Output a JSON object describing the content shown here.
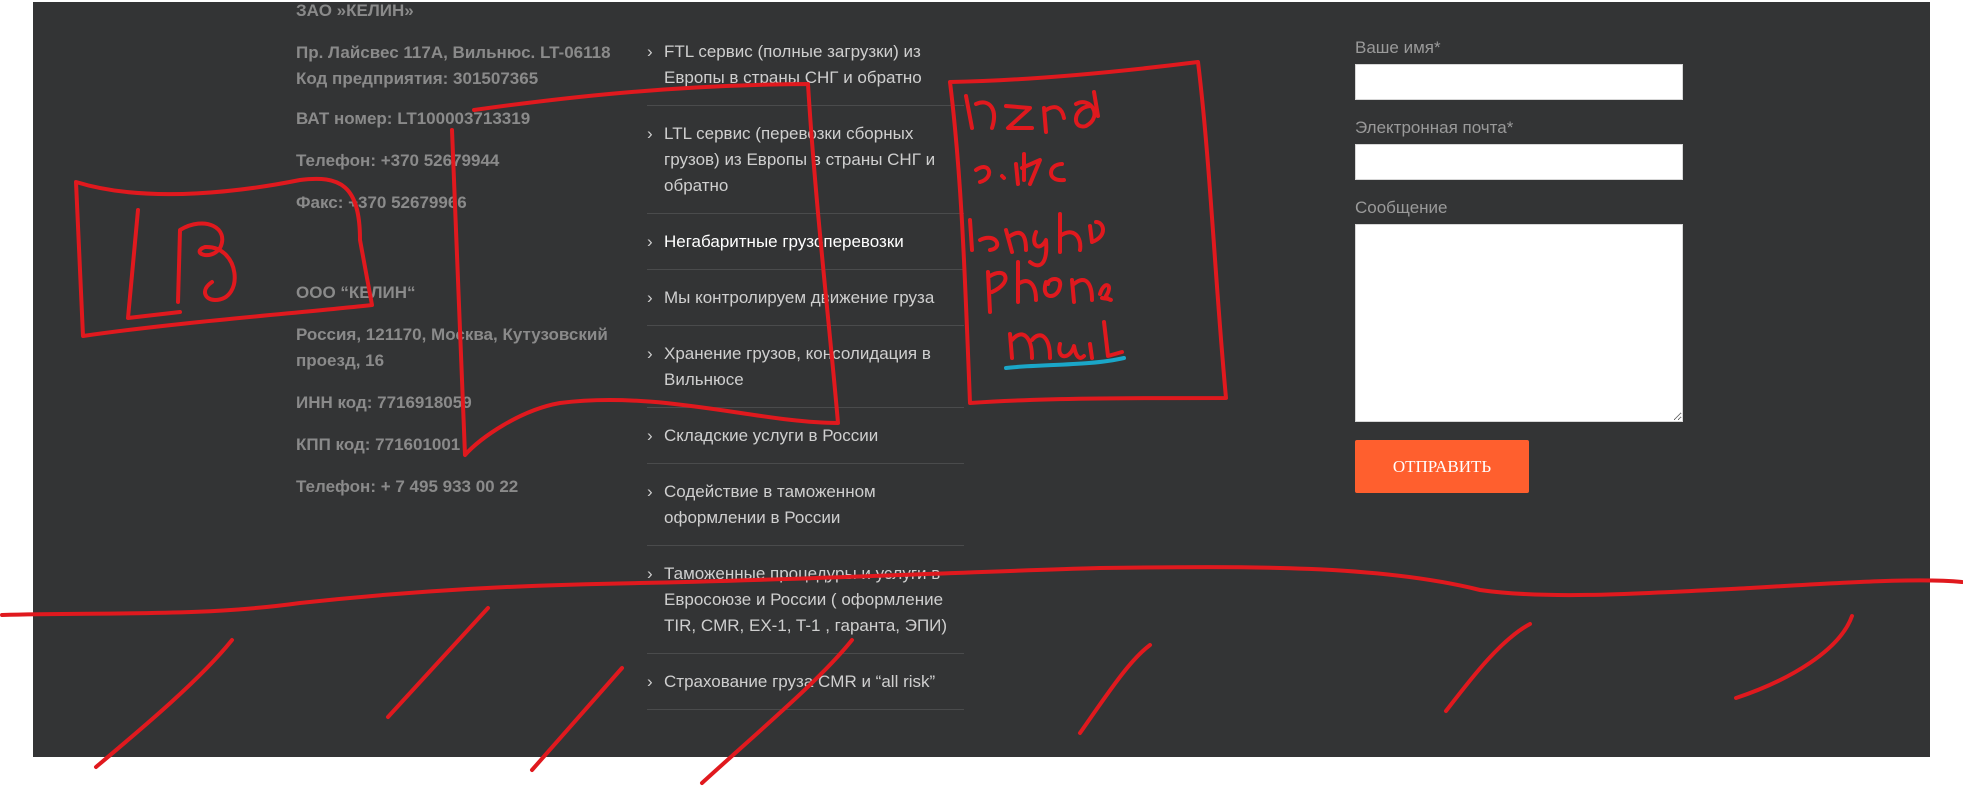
{
  "company_lt": {
    "name": "ЗАО »КЕЛИН»",
    "address": "Пр. Лайсвес 117А, Вильнюс. LT-06118",
    "company_code": "Код предприятия: 301507365",
    "vat": "ВАТ номер: LT100003713319",
    "phone": "Телефон: +370 52679944",
    "fax": "Факс: +370 52679966"
  },
  "company_ru": {
    "name": "ООО “КЕЛИН“",
    "address": "Россия, 121170, Москва, Кутузовский проезд, 16",
    "inn": "ИНН код: 7716918059",
    "kpp": "КПП код: 771601001",
    "phone": "Телефон: + 7 495 933 00 22"
  },
  "services": [
    "FTL сервис (полные загрузки) из Европы в страны СНГ и обратно",
    "LTL сервис (перевозки сборных грузов) из Европы в страны СНГ и обратно",
    "Негабаритные грузоперевозки",
    "Мы контролируем движение груза",
    "Хранение грузов, консолидация в Вильнюсе",
    "Складские услуги в России",
    "Содействие в таможенном оформлении в России",
    "Таможенные процедуры и услуги в Евросоюзе и России ( оформление TIR, CMR, EX-1, T-1 , гаранта, ЭПИ)",
    "Страхование груза CMR и “all risk”"
  ],
  "form": {
    "name_label": "Ваше имя*",
    "email_label": "Электронная почта*",
    "message_label": "Сообщение",
    "submit_label": "ОТПРАВИТЬ"
  },
  "annotations": {
    "stroke_color": "#e0191e",
    "underline_color": "#1aa6c8",
    "logo_box_text": "LG",
    "handwritten_note": "Name site length phone mail"
  },
  "colors": {
    "footer_bg": "#333435",
    "accent": "#ff5f2e"
  }
}
